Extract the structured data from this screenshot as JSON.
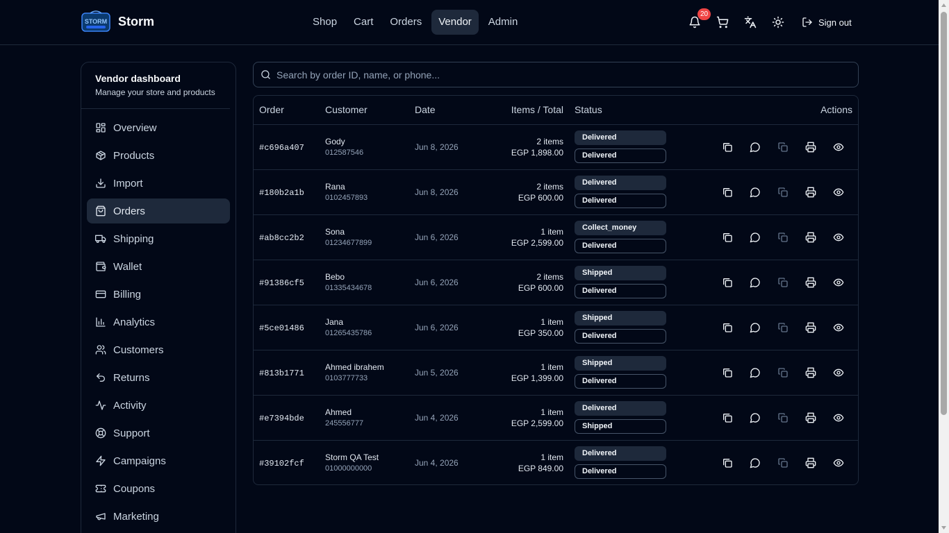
{
  "brand": {
    "name": "Storm",
    "logo_text": "STORM"
  },
  "nav": [
    {
      "label": "Shop",
      "active": false
    },
    {
      "label": "Cart",
      "active": false
    },
    {
      "label": "Orders",
      "active": false
    },
    {
      "label": "Vendor",
      "active": true
    },
    {
      "label": "Admin",
      "active": false
    }
  ],
  "top_actions": {
    "notifications_count": "20",
    "signout_label": "Sign out",
    "icons": [
      "bell-icon",
      "cart-icon",
      "translate-icon",
      "sun-icon",
      "logout-icon"
    ]
  },
  "sidebar": {
    "title": "Vendor dashboard",
    "subtitle": "Manage your store and products",
    "items": [
      {
        "label": "Overview",
        "icon": "dashboard-icon"
      },
      {
        "label": "Products",
        "icon": "package-icon"
      },
      {
        "label": "Import",
        "icon": "download-icon"
      },
      {
        "label": "Orders",
        "icon": "shopping-bag-icon",
        "active": true
      },
      {
        "label": "Shipping",
        "icon": "truck-icon"
      },
      {
        "label": "Wallet",
        "icon": "wallet-icon"
      },
      {
        "label": "Billing",
        "icon": "credit-card-icon"
      },
      {
        "label": "Analytics",
        "icon": "bar-chart-icon"
      },
      {
        "label": "Customers",
        "icon": "users-icon"
      },
      {
        "label": "Returns",
        "icon": "undo-icon"
      },
      {
        "label": "Activity",
        "icon": "activity-icon"
      },
      {
        "label": "Support",
        "icon": "lifebuoy-icon"
      },
      {
        "label": "Campaigns",
        "icon": "zap-icon"
      },
      {
        "label": "Coupons",
        "icon": "ticket-icon"
      },
      {
        "label": "Marketing",
        "icon": "megaphone-icon"
      }
    ]
  },
  "search": {
    "placeholder": "Search by order ID, name, or phone..."
  },
  "table": {
    "headers": {
      "order": "Order",
      "customer": "Customer",
      "date": "Date",
      "items": "Items / Total",
      "status": "Status",
      "actions": "Actions"
    },
    "rows": [
      {
        "id": "#c696a407",
        "name": "Gody",
        "phone": "012587546",
        "date": "Jun 8, 2026",
        "items": "2 items",
        "total": "EGP 1,898.00",
        "status": "Delivered",
        "shipping": "Delivered"
      },
      {
        "id": "#180b2a1b",
        "name": "Rana",
        "phone": "0102457893",
        "date": "Jun 8, 2026",
        "items": "2 items",
        "total": "EGP 600.00",
        "status": "Delivered",
        "shipping": "Delivered"
      },
      {
        "id": "#ab8cc2b2",
        "name": "Sona",
        "phone": "01234677899",
        "date": "Jun 6, 2026",
        "items": "1 item",
        "total": "EGP 2,599.00",
        "status": "Collect_money",
        "shipping": "Delivered"
      },
      {
        "id": "#91386cf5",
        "name": "Bebo",
        "phone": "01335434678",
        "date": "Jun 6, 2026",
        "items": "2 items",
        "total": "EGP 600.00",
        "status": "Shipped",
        "shipping": "Delivered"
      },
      {
        "id": "#5ce01486",
        "name": "Jana",
        "phone": "01265435786",
        "date": "Jun 6, 2026",
        "items": "1 item",
        "total": "EGP 350.00",
        "status": "Shipped",
        "shipping": "Delivered"
      },
      {
        "id": "#813b1771",
        "name": "Ahmed ibrahem",
        "phone": "0103777733",
        "date": "Jun 5, 2026",
        "items": "1 item",
        "total": "EGP 1,399.00",
        "status": "Shipped",
        "shipping": "Delivered"
      },
      {
        "id": "#e7394bde",
        "name": "Ahmed",
        "phone": "245556777",
        "date": "Jun 4, 2026",
        "items": "1 item",
        "total": "EGP 2,599.00",
        "status": "Delivered",
        "shipping": "Shipped"
      },
      {
        "id": "#39102fcf",
        "name": "Storm QA Test",
        "phone": "01000000000",
        "date": "Jun 4, 2026",
        "items": "1 item",
        "total": "EGP 849.00",
        "status": "Delivered",
        "shipping": "Delivered"
      }
    ],
    "row_actions": [
      "copy-icon",
      "chat-icon",
      "duplicate-icon",
      "printer-icon",
      "eye-icon"
    ]
  },
  "colors": {
    "background": "#020817",
    "border": "#1e293b",
    "active_bg": "#1e293b",
    "badge": "#ef4444"
  }
}
